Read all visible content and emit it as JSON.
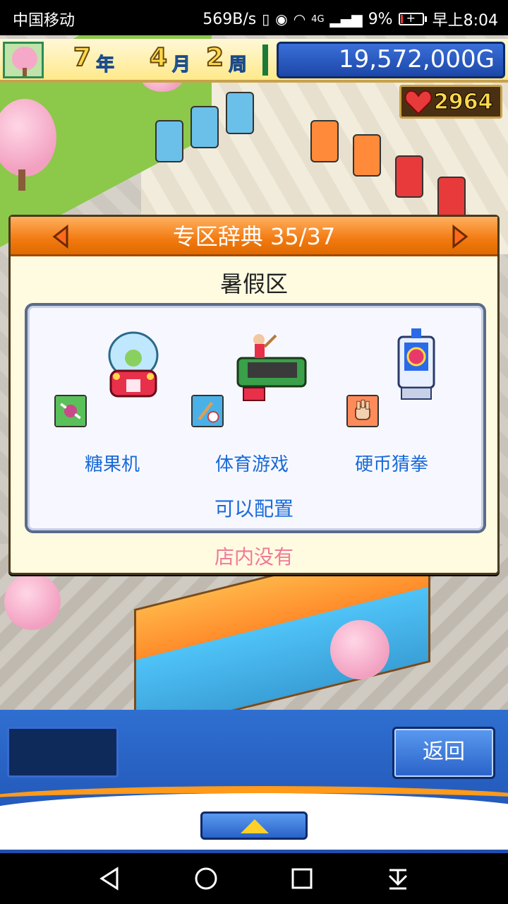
{
  "status_bar": {
    "carrier": "中国移动",
    "speed": "569B/s",
    "network": "4G",
    "battery": "9%",
    "time": "早上8:04"
  },
  "hud": {
    "year_num": "7",
    "year_unit": "年",
    "month_num": "4",
    "month_unit": "月",
    "week_num": "2",
    "week_unit": "周",
    "money": "19,572,000G",
    "hearts": "2964"
  },
  "dialog": {
    "title": "专区辞典 35/37",
    "zone_name": "暑假区",
    "items": [
      {
        "name": "糖果机",
        "category_icon": "candy-category-icon",
        "art_icon": "candy-machine-icon"
      },
      {
        "name": "体育游戏",
        "category_icon": "sports-category-icon",
        "art_icon": "sports-game-icon"
      },
      {
        "name": "硬币猜拳",
        "category_icon": "rock-paper-scissors-icon",
        "art_icon": "coin-game-machine-icon"
      }
    ],
    "status_configurable": "可以配置",
    "status_in_store": "店内没有"
  },
  "bottom": {
    "back_label": "返回"
  },
  "colors": {
    "accent_orange": "#f27a10",
    "item_text_blue": "#1a6ad8",
    "in_store_pink": "#f07a9a",
    "panel_blue": "#1e4fb0"
  }
}
